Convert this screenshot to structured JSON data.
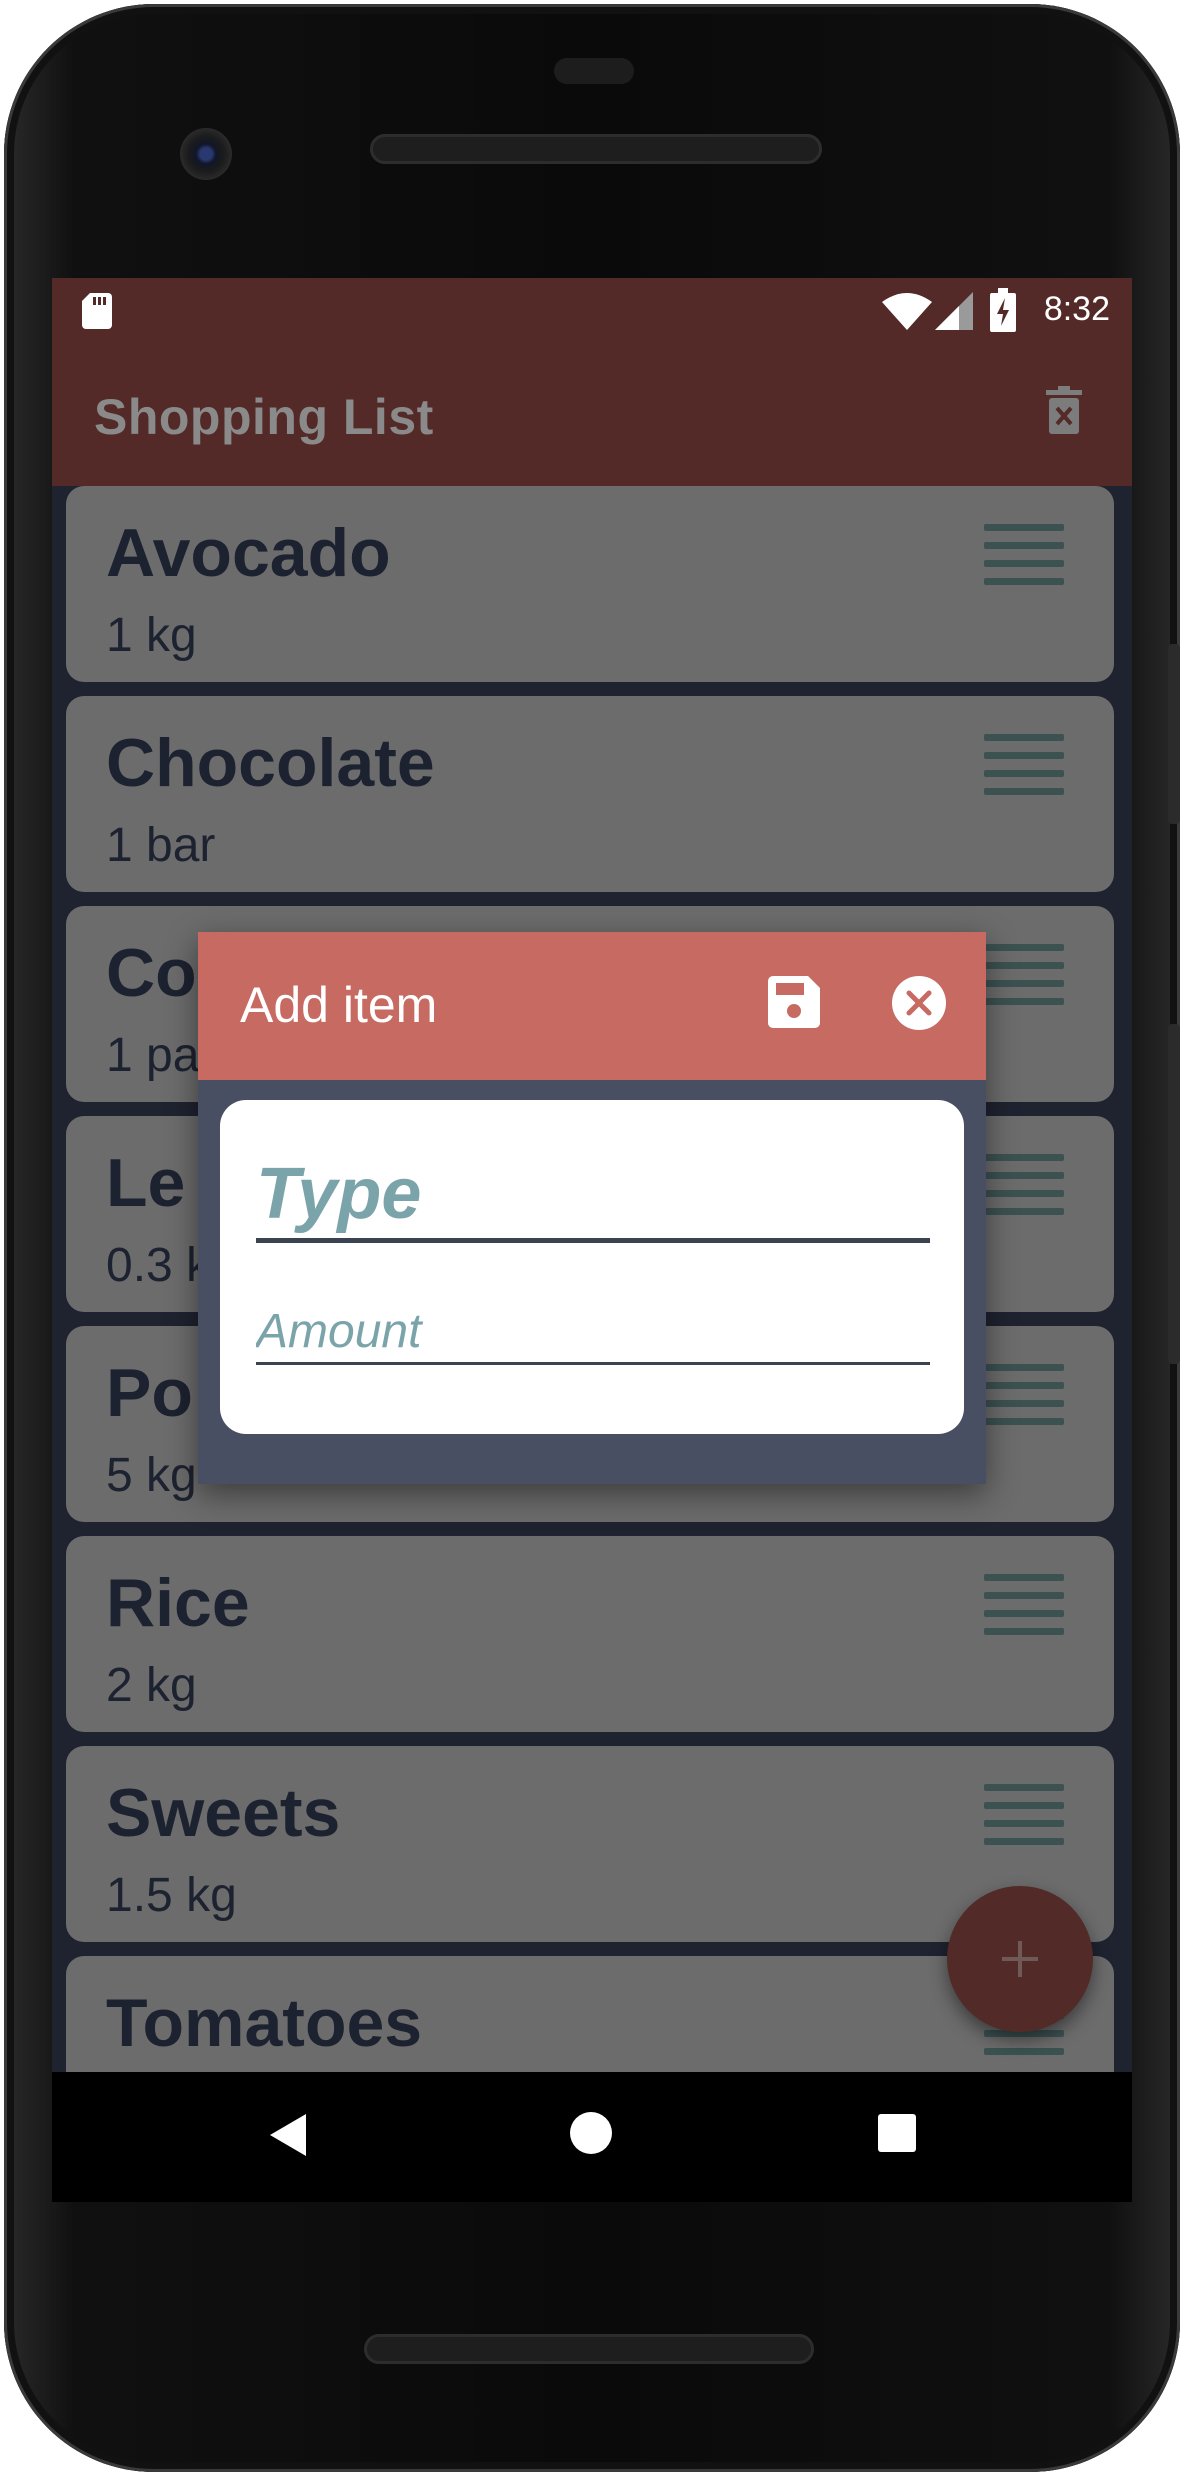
{
  "status_bar": {
    "time": "8:32"
  },
  "app_bar": {
    "title": "Shopping List",
    "delete_icon": "trash-icon"
  },
  "items": [
    {
      "name": "Avocado",
      "amount": "1 kg"
    },
    {
      "name": "Chocolate",
      "amount": "1 bar"
    },
    {
      "name": "Co",
      "amount": "1 pa"
    },
    {
      "name": "Le",
      "amount": "0.3 k"
    },
    {
      "name": "Po",
      "amount": "5 kg"
    },
    {
      "name": "Rice",
      "amount": "2 kg"
    },
    {
      "name": "Sweets",
      "amount": "1.5 kg"
    },
    {
      "name": "Tomatoes",
      "amount": ""
    }
  ],
  "dialog": {
    "title": "Add item",
    "type_placeholder": "Type",
    "amount_placeholder": "Amount",
    "save_icon": "floppy-disk-icon",
    "close_icon": "close-circle-icon"
  },
  "fab": {
    "label": "+"
  },
  "colors": {
    "app_bar": "#532a27",
    "dialog_header": "#c66a62",
    "dialog_frame": "#484f63",
    "card": "#6c6c6c",
    "hint": "#7ba4aa"
  }
}
